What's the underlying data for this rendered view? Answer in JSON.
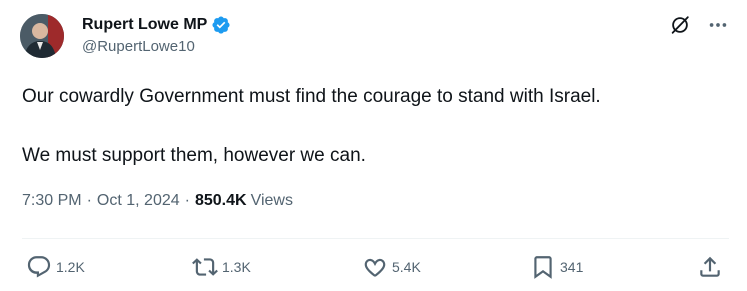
{
  "author": {
    "display_name": "Rupert Lowe MP",
    "handle": "@RupertLowe10",
    "verified": true
  },
  "tweet": {
    "lines": [
      "Our cowardly Government must find the courage to stand with Israel.",
      "We must support them, however we can."
    ],
    "time": "7:30 PM",
    "date": "Oct 1, 2024",
    "separator": "·",
    "views_count": "850.4K",
    "views_label": "Views"
  },
  "actions": {
    "replies": "1.2K",
    "reposts": "1.3K",
    "likes": "5.4K",
    "bookmarks": "341"
  },
  "icons": {
    "verified": "verified-badge-icon",
    "grok": "grok-icon",
    "more": "more-icon",
    "reply": "reply-icon",
    "repost": "repost-icon",
    "like": "like-icon",
    "bookmark": "bookmark-icon",
    "share": "share-icon"
  },
  "colors": {
    "text": "#0f1419",
    "secondary": "#536471",
    "verified": "#1d9bf0"
  }
}
